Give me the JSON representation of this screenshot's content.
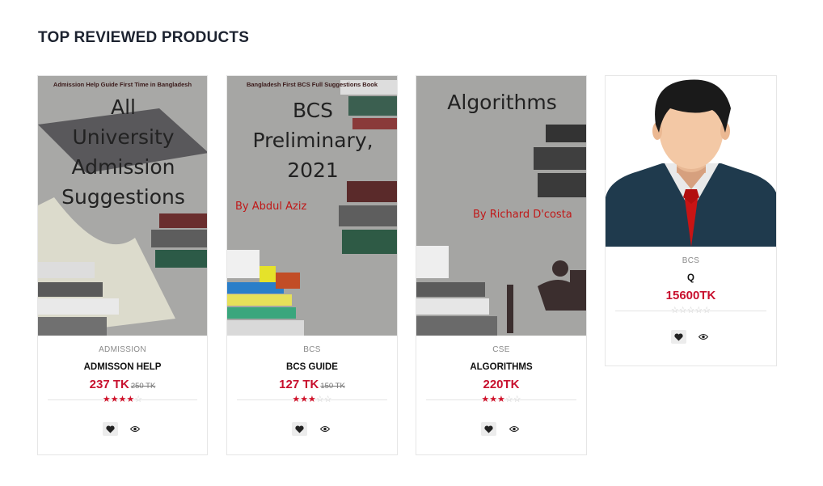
{
  "section": {
    "title": "TOP REVIEWED PRODUCTS"
  },
  "products": [
    {
      "category": "ADMISSION",
      "name": "ADMISSON HELP",
      "price": "237 TK",
      "old_price": "250 TK",
      "rating": 4,
      "cover": {
        "tag": "Admission Help Guide First Time in Bangladesh",
        "line1": "All",
        "line2": "University",
        "line3": "Admission",
        "line4": "Suggestions"
      }
    },
    {
      "category": "BCS",
      "name": "BCS GUIDE",
      "price": "127 TK",
      "old_price": "150 TK",
      "rating": 3,
      "cover": {
        "tag": "Bangladesh First BCS Full Suggestions Book",
        "line1": "BCS",
        "line2": "Preliminary,",
        "line3": "2021",
        "author": "By Abdul Aziz"
      }
    },
    {
      "category": "CSE",
      "name": "ALGORITHMS",
      "price": "220TK",
      "old_price": "",
      "rating": 3,
      "cover": {
        "line1": "Algorithms",
        "author": "By Richard D'costa"
      }
    },
    {
      "category": "BCS",
      "name": "Q",
      "price": "15600TK",
      "old_price": "",
      "rating": 0
    }
  ],
  "colors": {
    "accent": "#c8102e",
    "title": "#1d2330",
    "star_off": "#cfcfcf"
  },
  "icons": {
    "wishlist": "heart-icon",
    "quickview": "eye-icon"
  }
}
